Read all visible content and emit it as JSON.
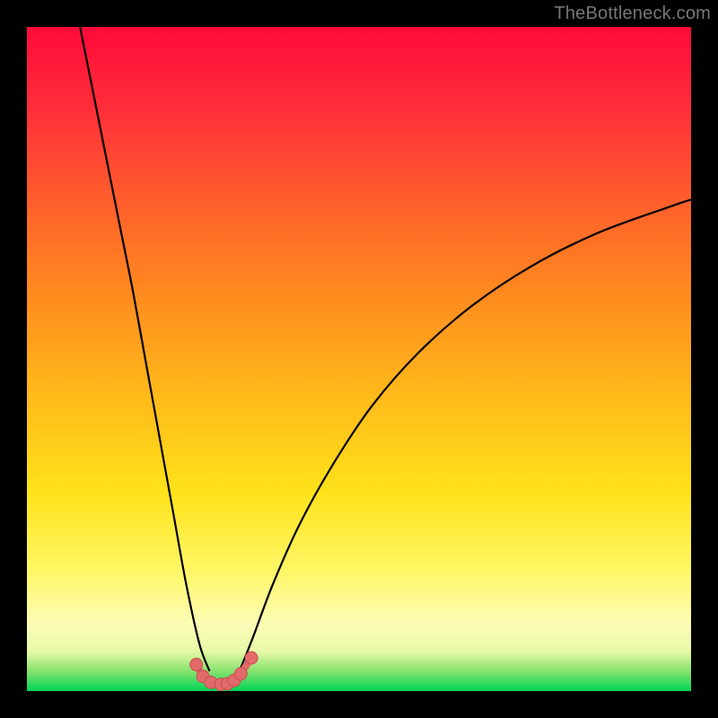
{
  "watermark": "TheBottleneck.com",
  "colors": {
    "frame": "#000000",
    "watermark": "#777777",
    "curve": "#000000",
    "marker_fill": "#e26a6a",
    "marker_stroke": "#c94f4f",
    "gradient_stops": [
      "#ff0a3a",
      "#ff2d3a",
      "#ff5a2d",
      "#ff8a1f",
      "#ffb81a",
      "#ffe21a",
      "#fff766",
      "#fcfcb7",
      "#e8f9a8",
      "#86e36e",
      "#00d457"
    ]
  },
  "chart_data": {
    "type": "line",
    "title": "",
    "xlabel": "",
    "ylabel": "",
    "xlim": [
      0,
      100
    ],
    "ylim": [
      0,
      100
    ],
    "grid": false,
    "legend": false,
    "series": [
      {
        "name": "bottleneck-curve-left",
        "x": [
          8,
          10,
          12,
          14,
          16,
          18,
          20,
          22,
          24,
          26,
          27.5
        ],
        "y": [
          100,
          90,
          80,
          70,
          60,
          49,
          38,
          27,
          16,
          7,
          3
        ]
      },
      {
        "name": "bottleneck-curve-right",
        "x": [
          32,
          34,
          37,
          41,
          46,
          52,
          59,
          67,
          76,
          86,
          97,
          100
        ],
        "y": [
          3,
          8,
          16,
          25,
          34,
          43,
          51,
          58,
          64,
          69,
          73,
          74
        ]
      }
    ],
    "markers": {
      "name": "bottom-dots",
      "x": [
        25.5,
        26.5,
        27.7,
        29.2,
        30.2,
        31.2,
        32.2,
        33.8
      ],
      "y": [
        4.0,
        2.2,
        1.3,
        1.0,
        1.1,
        1.6,
        2.6,
        5.0
      ]
    },
    "notes": "x and y are percentages of the plot area (0–100). y=0 is the bottom edge, y=100 is the top edge. Values are estimated from pixel positions; the original chart has no visible axes, ticks, or numeric labels."
  }
}
